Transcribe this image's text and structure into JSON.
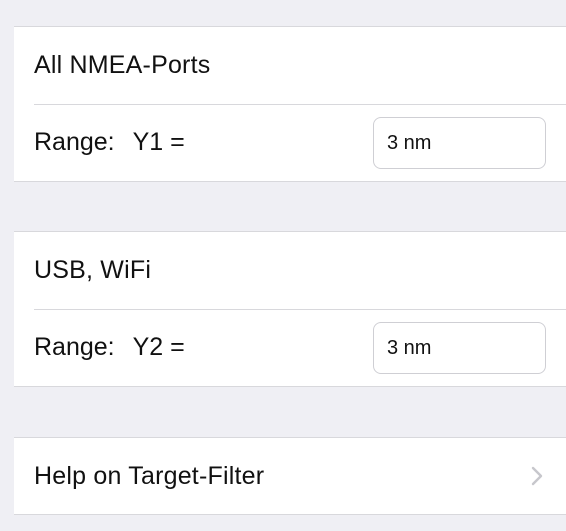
{
  "groups": [
    {
      "title": "All NMEA-Ports",
      "range_label": "Range:",
      "range_var": "Y1 =",
      "range_value": "3 nm"
    },
    {
      "title": "USB, WiFi",
      "range_label": "Range:",
      "range_var": "Y2 =",
      "range_value": "3 nm"
    }
  ],
  "help": {
    "label": "Help on Target-Filter",
    "chevron_icon": "chevron-right-icon"
  },
  "colors": {
    "background": "#efeff4",
    "cell": "#ffffff",
    "separator": "#d8d8dc",
    "chevron": "#c7c7cc"
  }
}
